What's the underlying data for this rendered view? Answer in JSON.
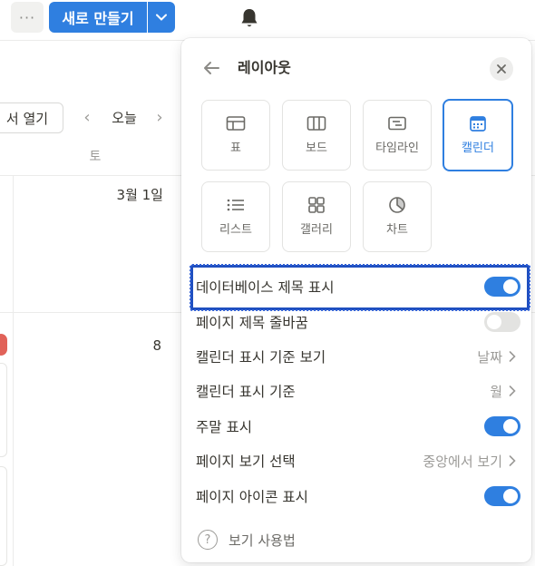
{
  "topbar": {
    "more_label": "···",
    "new_button_label": "새로 만들기"
  },
  "calendar": {
    "open_button_label": "서 열기",
    "prev_symbol": "‹",
    "today_label": "오늘",
    "next_symbol": "›",
    "weekday": "토",
    "date_mar1": "3월 1일",
    "date_8": "8"
  },
  "panel": {
    "title": "레이아웃",
    "layouts": [
      {
        "label": "표",
        "icon": "table-icon",
        "selected": false
      },
      {
        "label": "보드",
        "icon": "board-icon",
        "selected": false
      },
      {
        "label": "타임라인",
        "icon": "timeline-icon",
        "selected": false
      },
      {
        "label": "캘린더",
        "icon": "calendar-icon",
        "selected": true
      },
      {
        "label": "리스트",
        "icon": "list-icon",
        "selected": false
      },
      {
        "label": "갤러리",
        "icon": "gallery-icon",
        "selected": false
      },
      {
        "label": "차트",
        "icon": "chart-icon",
        "selected": false
      }
    ],
    "settings": [
      {
        "label": "데이터베이스 제목 표시",
        "type": "toggle",
        "on": true
      },
      {
        "label": "페이지 제목 줄바꿈",
        "type": "toggle",
        "on": false
      },
      {
        "label": "캘린더 표시 기준 보기",
        "type": "select",
        "value": "날짜"
      },
      {
        "label": "캘린더 표시 기준",
        "type": "select",
        "value": "월"
      },
      {
        "label": "주말 표시",
        "type": "toggle",
        "on": true
      },
      {
        "label": "페이지 보기 선택",
        "type": "select",
        "value": "중앙에서 보기"
      },
      {
        "label": "페이지 아이콘 표시",
        "type": "toggle",
        "on": true
      }
    ],
    "help_label": "보기 사용법",
    "help_symbol": "?"
  },
  "colors": {
    "accent": "#2f7fe0",
    "highlight_box": "#1f4fbf"
  }
}
